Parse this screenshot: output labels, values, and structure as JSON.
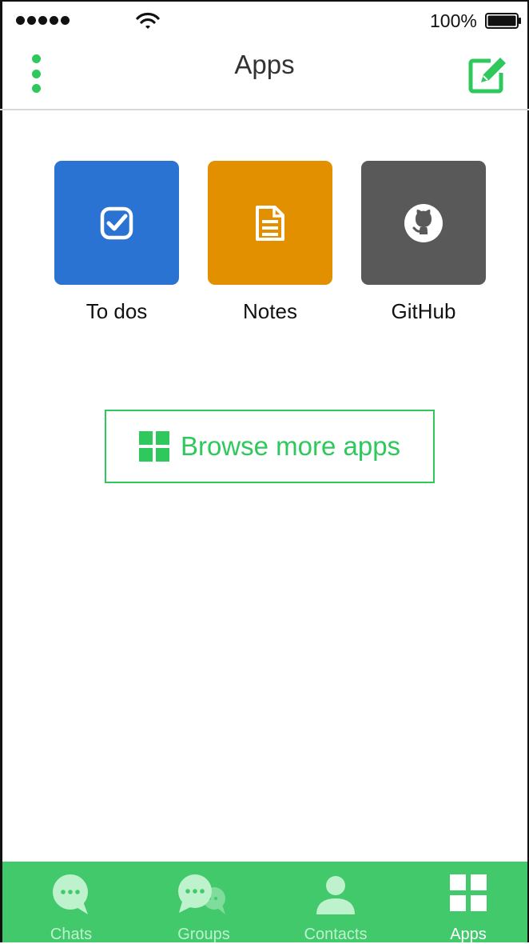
{
  "status_bar": {
    "battery_percent": "100%"
  },
  "nav": {
    "title": "Apps",
    "menu_icon": "vertical-dots-icon",
    "compose_icon": "compose-icon"
  },
  "apps": [
    {
      "label": "To dos",
      "icon": "checkbox-icon",
      "color": "#2a73d2"
    },
    {
      "label": "Notes",
      "icon": "note-icon",
      "color": "#e39000"
    },
    {
      "label": "GitHub",
      "icon": "github-icon",
      "color": "#595959"
    }
  ],
  "browse_button": {
    "label": "Browse more apps",
    "icon": "grid-icon"
  },
  "tab_bar": {
    "tabs": [
      {
        "label": "Chats",
        "icon": "chat-bubble-icon",
        "active": false
      },
      {
        "label": "Groups",
        "icon": "group-chat-icon",
        "active": false
      },
      {
        "label": "Contacts",
        "icon": "person-icon",
        "active": false
      },
      {
        "label": "Apps",
        "icon": "grid-icon",
        "active": true
      }
    ]
  },
  "colors": {
    "accent": "#2ec85d",
    "tabbar_bg": "#42c96c"
  }
}
